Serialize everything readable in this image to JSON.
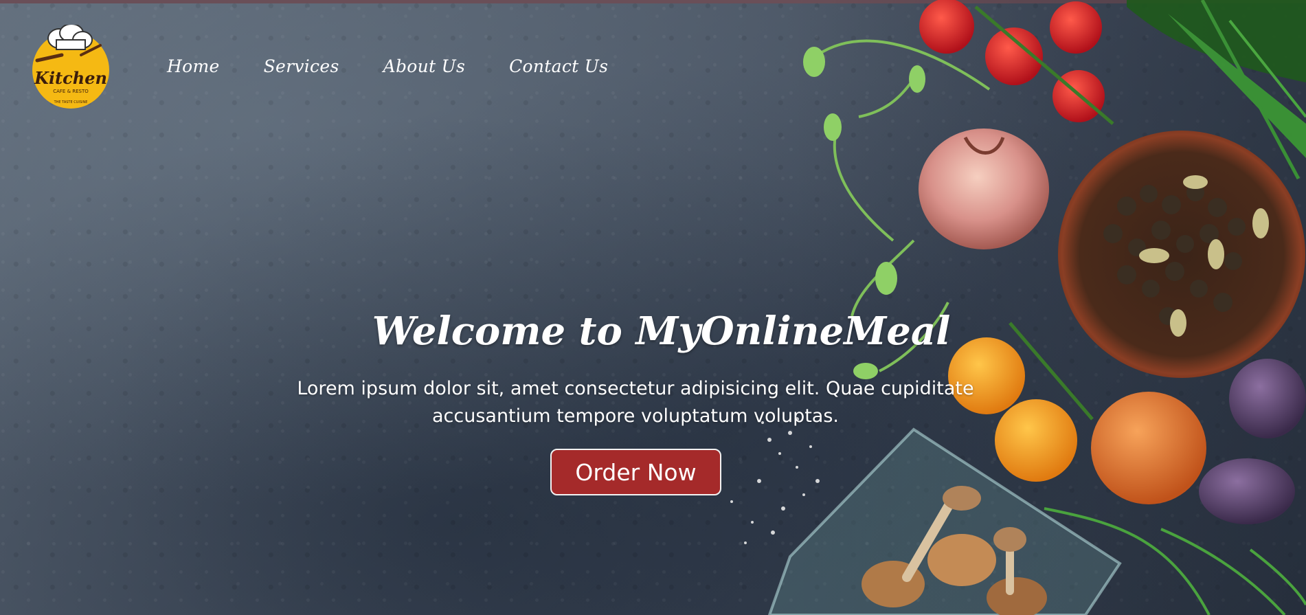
{
  "brand": {
    "logo_main": "Kitchen",
    "logo_sub": "CAFE & RESTO",
    "logo_tagline": "THE TASTE CUISINE"
  },
  "nav": {
    "items": [
      {
        "label": "Home"
      },
      {
        "label": "Services"
      },
      {
        "label": "About Us"
      },
      {
        "label": "Contact Us"
      }
    ]
  },
  "hero": {
    "title": "Welcome to MyOnlineMeal",
    "subtitle": "Lorem ipsum dolor sit, amet consectetur adipisicing elit. Quae cupiditate accusantium tempore voluptatum voluptas.",
    "button_label": "Order Now",
    "button_color": "#a52a2a",
    "logo_color": "#f5b913"
  }
}
